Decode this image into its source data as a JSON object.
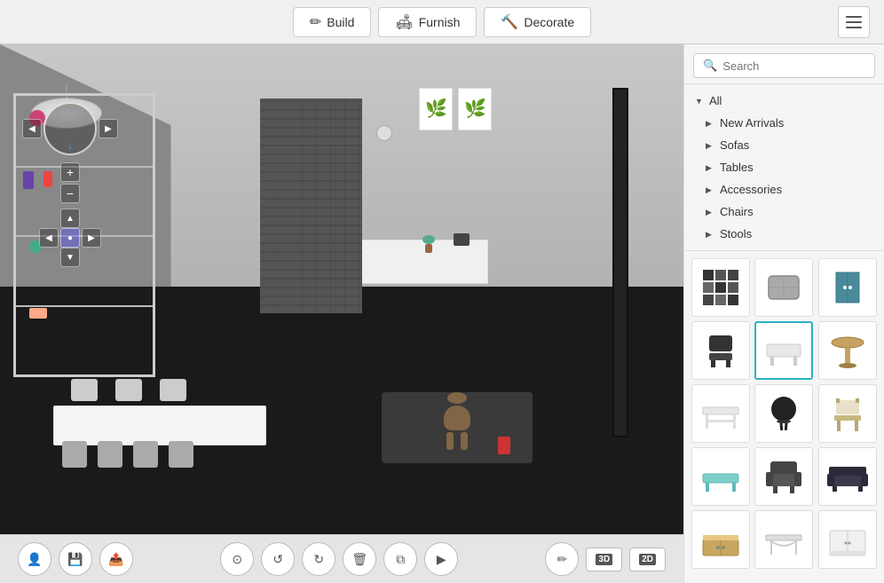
{
  "topbar": {
    "tabs": [
      {
        "id": "build",
        "label": "Build",
        "icon": "✏"
      },
      {
        "id": "furnish",
        "label": "Furnish",
        "icon": "🛋"
      },
      {
        "id": "decorate",
        "label": "Decorate",
        "icon": "🔨"
      }
    ]
  },
  "search": {
    "placeholder": "Search"
  },
  "categories": {
    "all_label": "All",
    "items": [
      {
        "id": "new-arrivals",
        "label": "New Arrivals"
      },
      {
        "id": "sofas",
        "label": "Sofas"
      },
      {
        "id": "tables",
        "label": "Tables"
      },
      {
        "id": "accessories",
        "label": "Accessories"
      },
      {
        "id": "chairs",
        "label": "Chairs"
      },
      {
        "id": "stools",
        "label": "Stools"
      }
    ]
  },
  "furniture_grid": {
    "items": [
      {
        "id": 1,
        "type": "wall-deco",
        "selected": false
      },
      {
        "id": 2,
        "type": "cushion",
        "selected": false
      },
      {
        "id": 3,
        "type": "cabinet",
        "selected": false
      },
      {
        "id": 4,
        "type": "chair-dark",
        "selected": false
      },
      {
        "id": 5,
        "type": "coffee-table",
        "selected": true
      },
      {
        "id": 6,
        "type": "side-table",
        "selected": false
      },
      {
        "id": 7,
        "type": "side-table-white",
        "selected": false
      },
      {
        "id": 8,
        "type": "chair-black",
        "selected": false
      },
      {
        "id": 9,
        "type": "chair-wood",
        "selected": false
      },
      {
        "id": 10,
        "type": "coffee-table-teal",
        "selected": false
      },
      {
        "id": 11,
        "type": "armchair",
        "selected": false
      },
      {
        "id": 12,
        "type": "sofa-dark",
        "selected": false
      },
      {
        "id": 13,
        "type": "storage-wood",
        "selected": false
      },
      {
        "id": 14,
        "type": "table-metal",
        "selected": false
      },
      {
        "id": 15,
        "type": "cabinet-white",
        "selected": false
      }
    ]
  },
  "bottom_controls": {
    "left": [
      {
        "id": "user",
        "icon": "👤",
        "label": "User"
      },
      {
        "id": "save",
        "icon": "💾",
        "label": "Save"
      },
      {
        "id": "share",
        "icon": "📤",
        "label": "Share"
      }
    ],
    "center": [
      {
        "id": "rotate-left",
        "icon": "⟲",
        "label": "Rotate Left"
      },
      {
        "id": "reset",
        "icon": "↺",
        "label": "Reset"
      },
      {
        "id": "delete",
        "icon": "🗑",
        "label": "Delete"
      },
      {
        "id": "copy",
        "icon": "⊞",
        "label": "Copy"
      },
      {
        "id": "play",
        "icon": "▶",
        "label": "Play"
      }
    ],
    "right": [
      {
        "id": "pencil",
        "icon": "✏",
        "label": "Edit"
      },
      {
        "id": "view-3d",
        "label": "3D"
      },
      {
        "id": "view-2d",
        "label": "2D"
      }
    ]
  }
}
